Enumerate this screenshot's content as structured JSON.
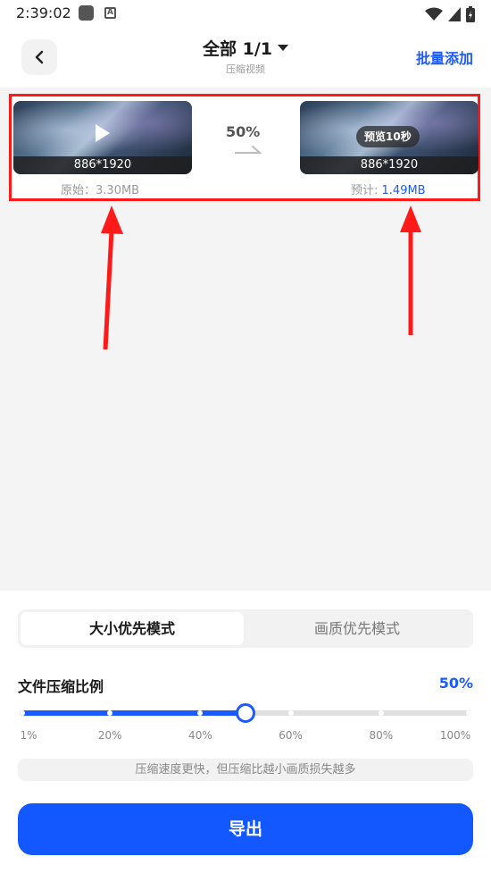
{
  "status_bar": {
    "time": "2:39:02",
    "app_icons": [
      "app-square-icon",
      "font-a-icon"
    ],
    "system_icons": [
      "wifi-icon",
      "signal-icon",
      "battery-charging-icon"
    ]
  },
  "header": {
    "title": "全部 1/1",
    "subtitle": "压缩视频",
    "batch_add_label": "批量添加",
    "back_icon": "chevron-left-icon"
  },
  "compare": {
    "original": {
      "resolution": "886*1920",
      "size_label": "原始：",
      "size_value": "3.30MB"
    },
    "ratio_text": "50%",
    "estimated": {
      "resolution": "886*1920",
      "preview_label": "预览10秒",
      "size_label": "预计: ",
      "size_value": "1.49MB"
    }
  },
  "panel": {
    "modes": [
      "大小优先模式",
      "画质优先模式"
    ],
    "active_mode": "大小优先模式",
    "ratio_label": "文件压缩比例",
    "ratio_value": "50%",
    "slider": {
      "value_percent": 50,
      "ticks": [
        "1%",
        "20%",
        "40%",
        "60%",
        "80%",
        "100%"
      ]
    },
    "hint": "压缩速度更快，但压缩比越小画质损失越多",
    "export_label": "导出"
  },
  "colors": {
    "accent": "#1a5bff",
    "annotation_red": "#ff1a1a"
  }
}
